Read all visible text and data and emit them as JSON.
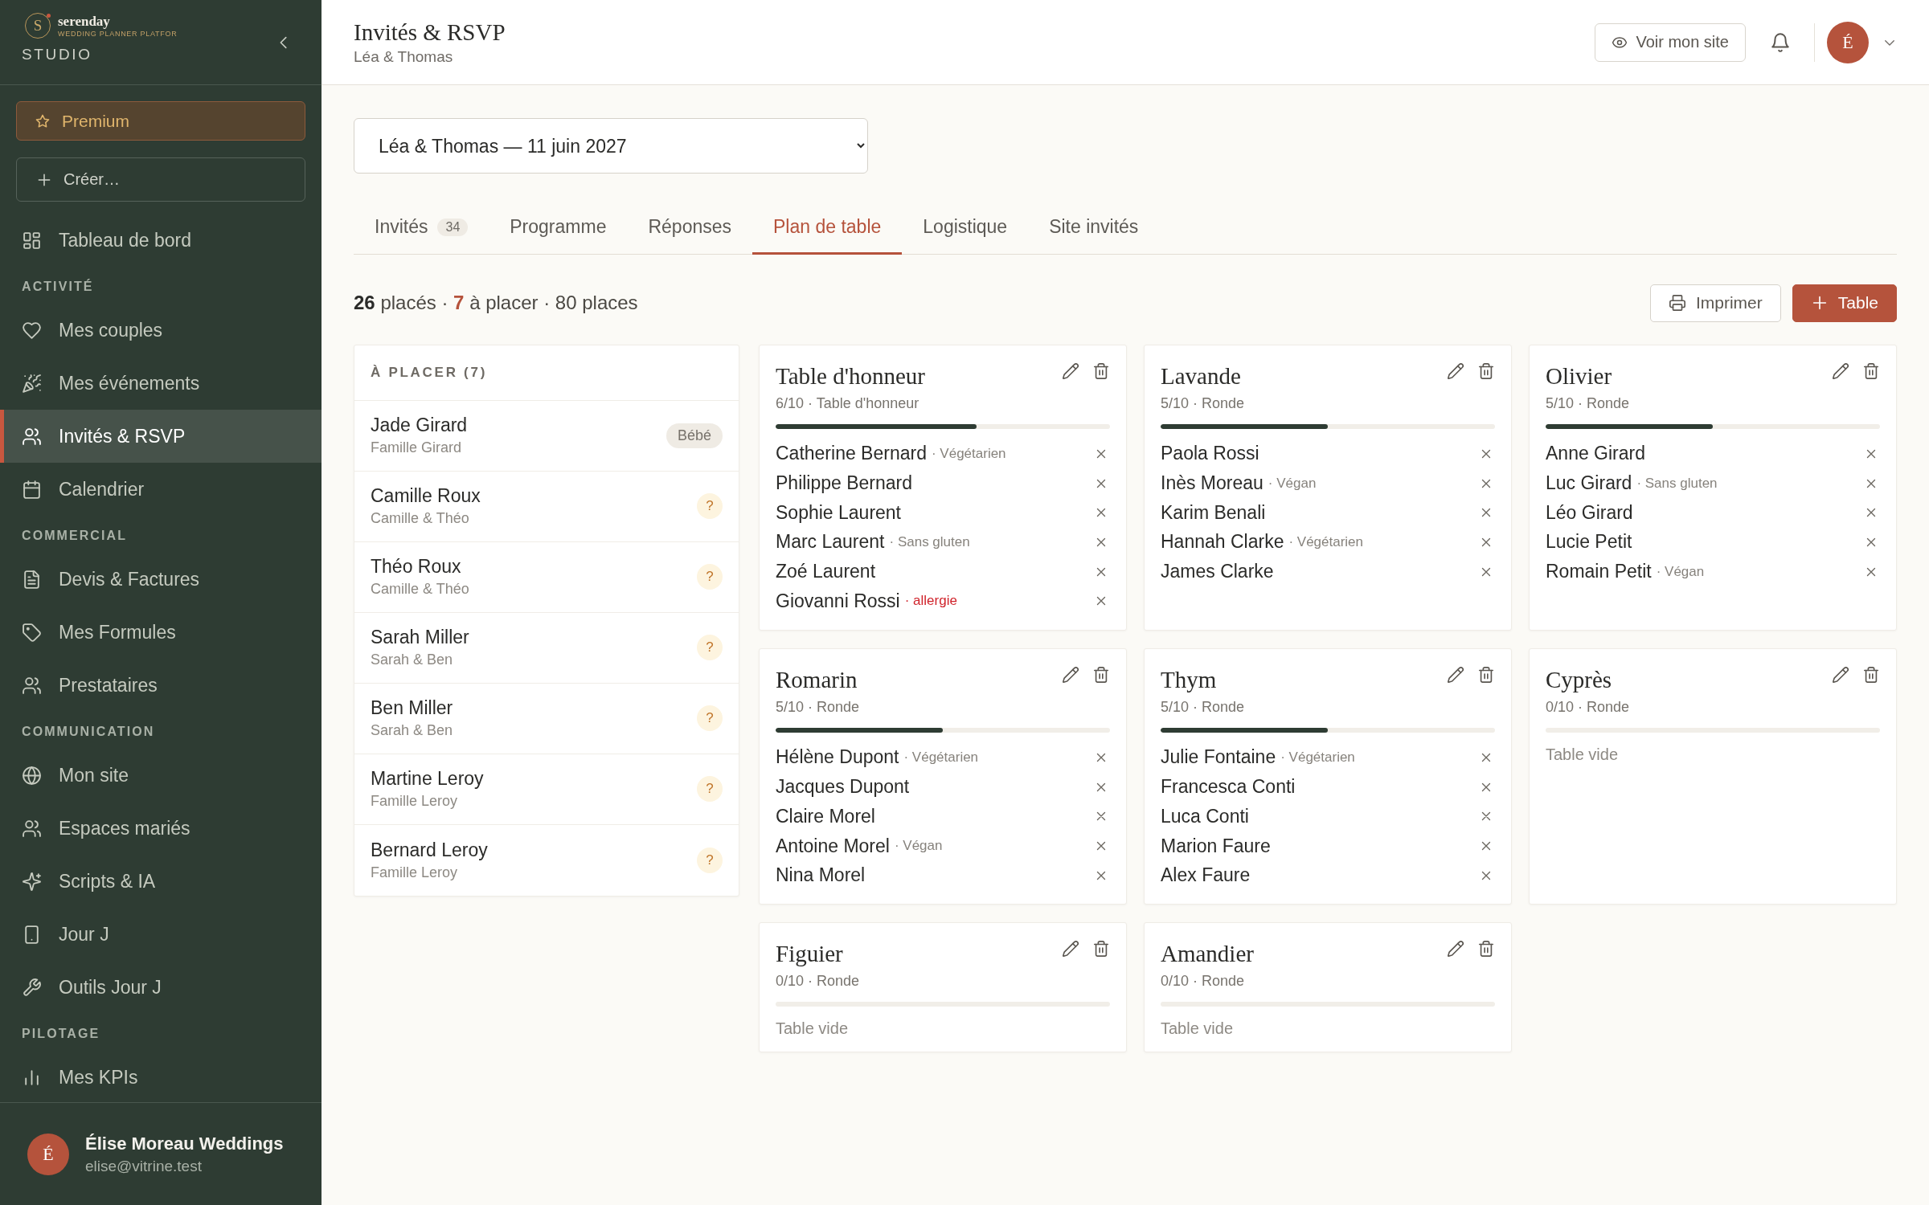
{
  "sidebar": {
    "logo": {
      "mark": "S",
      "name": "serenday",
      "tagline": "WEDDING PLANNER PLATFOR"
    },
    "workspace": "STUDIO",
    "premium_button": "Premium",
    "create_button": "Créer…",
    "nav": [
      {
        "kind": "link",
        "label": "Tableau de bord",
        "selected": false
      },
      {
        "kind": "heading",
        "label": "ACTIVITÉ"
      },
      {
        "kind": "link",
        "label": "Mes couples",
        "selected": false
      },
      {
        "kind": "link",
        "label": "Mes événements",
        "selected": false
      },
      {
        "kind": "link",
        "label": "Invités & RSVP",
        "selected": true
      },
      {
        "kind": "link",
        "label": "Calendrier",
        "selected": false
      },
      {
        "kind": "heading",
        "label": "COMMERCIAL"
      },
      {
        "kind": "link",
        "label": "Devis & Factures",
        "selected": false
      },
      {
        "kind": "link",
        "label": "Mes Formules",
        "selected": false
      },
      {
        "kind": "link",
        "label": "Prestataires",
        "selected": false
      },
      {
        "kind": "heading",
        "label": "COMMUNICATION"
      },
      {
        "kind": "link",
        "label": "Mon site",
        "selected": false
      },
      {
        "kind": "link",
        "label": "Espaces mariés",
        "selected": false
      },
      {
        "kind": "link",
        "label": "Scripts & IA",
        "selected": false
      },
      {
        "kind": "link",
        "label": "Jour J",
        "selected": false
      },
      {
        "kind": "link",
        "label": "Outils Jour J",
        "selected": false
      },
      {
        "kind": "heading",
        "label": "PILOTAGE"
      },
      {
        "kind": "link",
        "label": "Mes KPIs",
        "selected": false
      }
    ],
    "account": {
      "initial": "É",
      "name": "Élise Moreau Weddings",
      "email": "elise@vitrine.test"
    }
  },
  "header": {
    "title": "Invités & RSVP",
    "subtitle": "Léa & Thomas",
    "site_button": "Voir mon site",
    "avatar_initial": "É"
  },
  "event_select": {
    "value": "Léa & Thomas — 11 juin 2027"
  },
  "tabs": [
    {
      "label": "Invités",
      "badge": "34",
      "selected": false
    },
    {
      "label": "Programme",
      "selected": false
    },
    {
      "label": "Réponses",
      "selected": false
    },
    {
      "label": "Plan de table",
      "selected": true
    },
    {
      "label": "Logistique",
      "selected": false
    },
    {
      "label": "Site invités",
      "selected": false
    }
  ],
  "summary": [
    {
      "text": "26",
      "kind": "count"
    },
    {
      "text": "placés ·",
      "kind": "label"
    },
    {
      "text": "7",
      "kind": "alert"
    },
    {
      "text": "à placer · 80 places",
      "kind": "label"
    }
  ],
  "print_button": "Imprimer",
  "add_table_button": "Table",
  "unplaced": {
    "title": "À PLACER (7)",
    "guests": [
      {
        "name": "Jade Girard",
        "group": "Famille Girard",
        "tag": {
          "kind": "label",
          "text": "Bébé"
        }
      },
      {
        "name": "Camille Roux",
        "group": "Camille & Théo",
        "tag": {
          "kind": "pending",
          "text": "?"
        }
      },
      {
        "name": "Théo Roux",
        "group": "Camille & Théo",
        "tag": {
          "kind": "pending",
          "text": "?"
        }
      },
      {
        "name": "Sarah Miller",
        "group": "Sarah & Ben",
        "tag": {
          "kind": "pending",
          "text": "?"
        }
      },
      {
        "name": "Ben Miller",
        "group": "Sarah & Ben",
        "tag": {
          "kind": "pending",
          "text": "?"
        }
      },
      {
        "name": "Martine Leroy",
        "group": "Famille Leroy",
        "tag": {
          "kind": "pending",
          "text": "?"
        }
      },
      {
        "name": "Bernard Leroy",
        "group": "Famille Leroy",
        "tag": {
          "kind": "pending",
          "text": "?"
        }
      }
    ]
  },
  "tables": [
    {
      "name": "Table d'honneur",
      "summary": "6/10 · Table d'honneur",
      "level": 0.6,
      "guests": [
        {
          "name": "Catherine Bernard",
          "note": {
            "text": "· Végétarien",
            "kind": "diet"
          }
        },
        {
          "name": "Philippe Bernard"
        },
        {
          "name": "Sophie Laurent"
        },
        {
          "name": "Marc Laurent",
          "note": {
            "text": "· Sans gluten",
            "kind": "diet"
          }
        },
        {
          "name": "Zoé Laurent"
        },
        {
          "name": "Giovanni Rossi",
          "note": {
            "text": "· allergie",
            "kind": "alert"
          }
        }
      ]
    },
    {
      "name": "Lavande",
      "summary": "5/10 · Ronde",
      "level": 0.5,
      "guests": [
        {
          "name": "Paola Rossi"
        },
        {
          "name": "Inès Moreau",
          "note": {
            "text": "· Végan",
            "kind": "diet"
          }
        },
        {
          "name": "Karim Benali"
        },
        {
          "name": "Hannah Clarke",
          "note": {
            "text": "· Végétarien",
            "kind": "diet"
          }
        },
        {
          "name": "James Clarke"
        }
      ]
    },
    {
      "name": "Olivier",
      "summary": "5/10 · Ronde",
      "level": 0.5,
      "guests": [
        {
          "name": "Anne Girard"
        },
        {
          "name": "Luc Girard",
          "note": {
            "text": "· Sans gluten",
            "kind": "diet"
          }
        },
        {
          "name": "Léo Girard"
        },
        {
          "name": "Lucie Petit"
        },
        {
          "name": "Romain Petit",
          "note": {
            "text": "· Végan",
            "kind": "diet"
          }
        }
      ]
    },
    {
      "name": "Romarin",
      "summary": "5/10 · Ronde",
      "level": 0.5,
      "guests": [
        {
          "name": "Hélène Dupont",
          "note": {
            "text": "· Végétarien",
            "kind": "diet"
          }
        },
        {
          "name": "Jacques Dupont"
        },
        {
          "name": "Claire Morel"
        },
        {
          "name": "Antoine Morel",
          "note": {
            "text": "· Végan",
            "kind": "diet"
          }
        },
        {
          "name": "Nina Morel"
        }
      ]
    },
    {
      "name": "Thym",
      "summary": "5/10 · Ronde",
      "level": 0.5,
      "guests": [
        {
          "name": "Julie Fontaine",
          "note": {
            "text": "· Végétarien",
            "kind": "diet"
          }
        },
        {
          "name": "Francesca Conti"
        },
        {
          "name": "Luca Conti"
        },
        {
          "name": "Marion Faure"
        },
        {
          "name": "Alex Faure"
        }
      ]
    },
    {
      "name": "Cyprès",
      "summary": "0/10 · Ronde",
      "empty_note": "Table vide"
    },
    {
      "name": "Figuier",
      "summary": "0/10 · Ronde",
      "empty_note": "Table vide"
    },
    {
      "name": "Amandier",
      "summary": "0/10 · Ronde",
      "empty_note": "Table vide"
    }
  ]
}
